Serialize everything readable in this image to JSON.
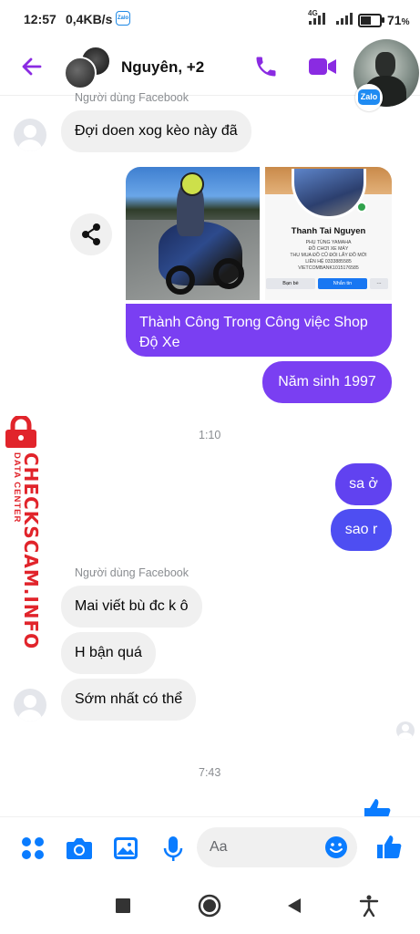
{
  "status_bar": {
    "time": "12:57",
    "speed": "0,4KB/s",
    "zalo_icon": "Zalo",
    "network": "4G",
    "battery_pct": "71",
    "battery_symbol": "%",
    "battery_level": 0.71
  },
  "header": {
    "title": "Nguyên, +2",
    "zalo_badge": "Zalo"
  },
  "messages": {
    "sender_top": "Người dùng Facebook",
    "msg1": "Đợi doen xog kèo này đã",
    "profile": {
      "name": "Thanh Tai Nguyen",
      "line1": "PHỤ TÙNG YAMAHA",
      "line2": "ĐỒ CHƠI XE MÁY",
      "line3": "THU MUA ĐỒ CŨ ĐỔI LẤY ĐỒ MỚI",
      "line4": "LIÊN HỆ 0333885585",
      "line5": "VIETCOMBANK1015176585",
      "btn_friends": "Bạn bè",
      "btn_message": "Nhắn tin",
      "btn_more": "···"
    },
    "caption": "Thành Công Trong Công việc Shop Độ Xe",
    "birth": "Năm sinh 1997",
    "time1": "1:10",
    "out1": "sa ở",
    "out2": "sao r",
    "sender_bottom": "Người dùng Facebook",
    "in2": "Mai viết bù đc k ô",
    "in3": "H bận quá",
    "in4": "Sớm nhất có thể",
    "time2": "7:43"
  },
  "watermark": {
    "big": "CHECKSCAM.INFO",
    "small": "DATA CENTER"
  },
  "composer": {
    "placeholder": "Aa"
  },
  "colors": {
    "accent": "#8a2be2",
    "bubble_out": "#7a3ff2",
    "bubble_in": "#f0f0f0",
    "messenger_blue": "#0a7cff",
    "watermark_red": "#e1242b"
  },
  "icons": {
    "back": "back-arrow-icon",
    "call": "phone-icon",
    "video": "video-camera-icon",
    "share": "share-icon",
    "apps": "apps-grid-icon",
    "camera": "camera-icon",
    "gallery": "image-icon",
    "mic": "microphone-icon",
    "emoji": "emoji-icon",
    "like": "thumbs-up-icon"
  }
}
